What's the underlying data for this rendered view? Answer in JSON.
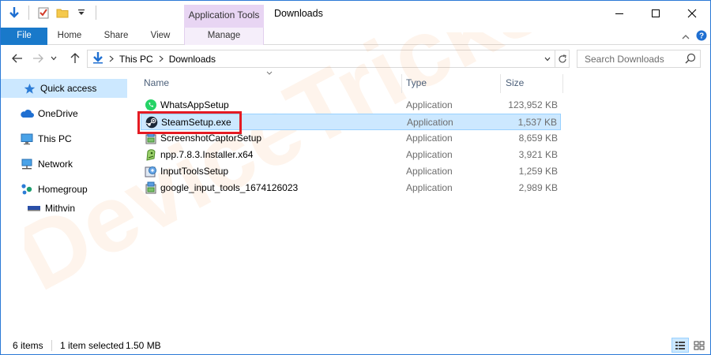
{
  "window": {
    "title": "Downloads",
    "context_tab_group": "Application Tools"
  },
  "ribbon": {
    "tabs": [
      "File",
      "Home",
      "Share",
      "View",
      "Manage"
    ]
  },
  "address": {
    "crumbs": [
      "This PC",
      "Downloads"
    ]
  },
  "search": {
    "placeholder": "Search Downloads"
  },
  "nav": {
    "items": [
      {
        "label": "Quick access",
        "icon": "star-icon"
      },
      {
        "label": "OneDrive",
        "icon": "cloud-icon"
      },
      {
        "label": "This PC",
        "icon": "computer-icon"
      },
      {
        "label": "Network",
        "icon": "network-icon"
      },
      {
        "label": "Homegroup",
        "icon": "homegroup-icon"
      },
      {
        "label": "Mithvin",
        "icon": "user-computer-icon"
      }
    ]
  },
  "columns": {
    "name": "Name",
    "type": "Type",
    "size": "Size"
  },
  "files": [
    {
      "name": "WhatsAppSetup",
      "type": "Application",
      "size": "123,952 KB",
      "icon": "whatsapp-icon"
    },
    {
      "name": "SteamSetup.exe",
      "type": "Application",
      "size": "1,537 KB",
      "icon": "steam-icon"
    },
    {
      "name": "ScreenshotCaptorSetup",
      "type": "Application",
      "size": "8,659 KB",
      "icon": "installer-icon"
    },
    {
      "name": "npp.7.8.3.Installer.x64",
      "type": "Application",
      "size": "3,921 KB",
      "icon": "notepadpp-icon"
    },
    {
      "name": "InputToolsSetup",
      "type": "Application",
      "size": "1,259 KB",
      "icon": "setup-icon"
    },
    {
      "name": "google_input_tools_1674126023",
      "type": "Application",
      "size": "2,989 KB",
      "icon": "installer-icon"
    }
  ],
  "status": {
    "item_count": "6 items",
    "selection": "1 item selected",
    "selection_size": "1.50 MB"
  },
  "watermark": {
    "text": "DeviceTricks"
  },
  "colors": {
    "accent": "#1979ca",
    "selection": "#cce8ff",
    "context_tab": "#e8d5f3",
    "highlight": "#e41b23"
  }
}
